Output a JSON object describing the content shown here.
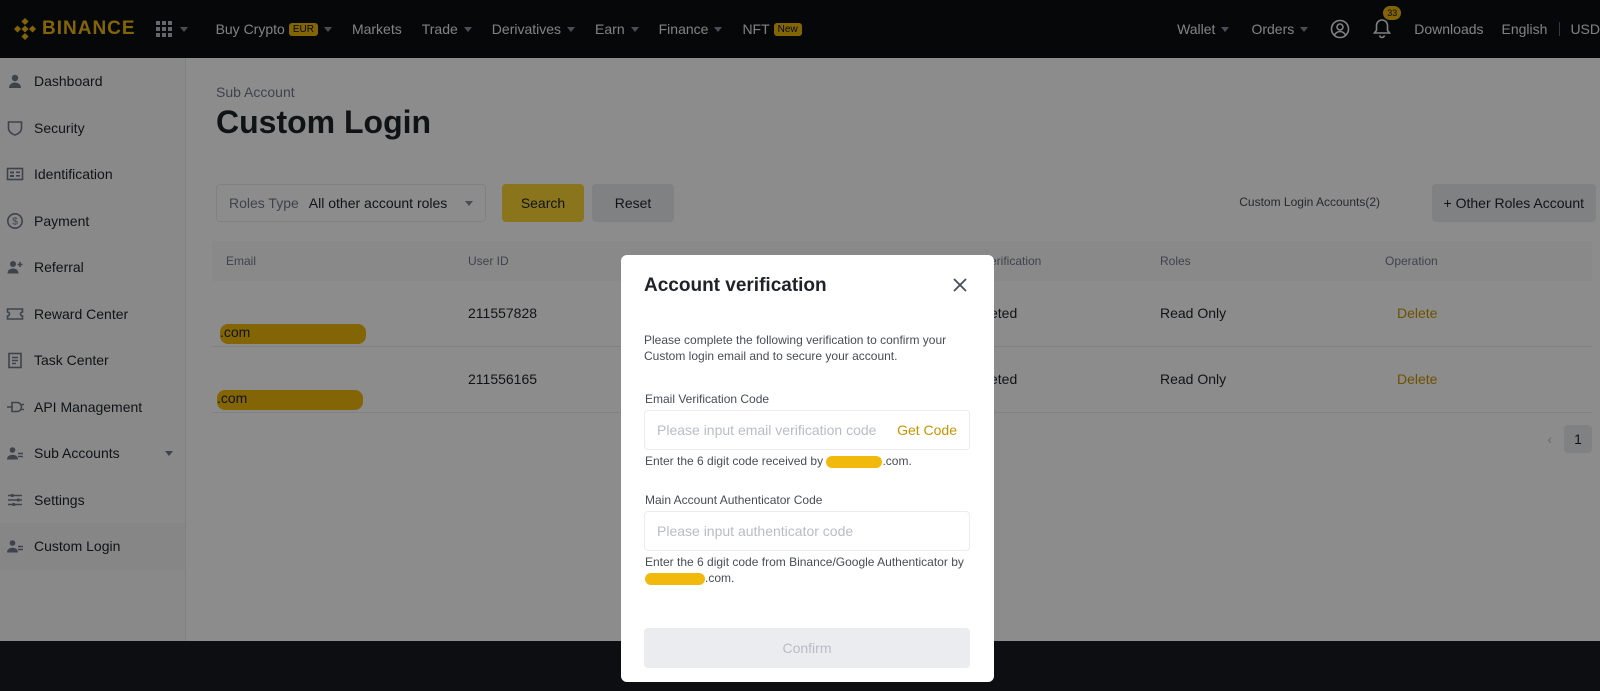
{
  "topbar": {
    "logo": "BINANCE",
    "nav": [
      {
        "label": "Buy Crypto",
        "badge": "EUR"
      },
      {
        "label": "Markets"
      },
      {
        "label": "Trade"
      },
      {
        "label": "Derivatives"
      },
      {
        "label": "Earn"
      },
      {
        "label": "Finance"
      },
      {
        "label": "NFT",
        "badge": "New"
      }
    ],
    "right": {
      "wallet": "Wallet",
      "orders": "Orders",
      "notification_count": "33",
      "downloads": "Downloads",
      "language": "English",
      "currency": "USD"
    }
  },
  "sidebar": {
    "items": [
      {
        "label": "Dashboard",
        "icon": "user-icon"
      },
      {
        "label": "Security",
        "icon": "shield-icon"
      },
      {
        "label": "Identification",
        "icon": "id-card-icon"
      },
      {
        "label": "Payment",
        "icon": "dollar-icon"
      },
      {
        "label": "Referral",
        "icon": "user-plus-icon"
      },
      {
        "label": "Reward Center",
        "icon": "ticket-icon"
      },
      {
        "label": "Task Center",
        "icon": "clipboard-icon"
      },
      {
        "label": "API Management",
        "icon": "plug-icon"
      },
      {
        "label": "Sub Accounts",
        "icon": "users-icon"
      },
      {
        "label": "Settings",
        "icon": "sliders-icon"
      },
      {
        "label": "Custom Login",
        "icon": "users-icon",
        "active": true
      }
    ]
  },
  "main": {
    "breadcrumb": "Sub Account",
    "title": "Custom Login",
    "filter": {
      "roles_type_label": "Roles Type",
      "roles_type_value": "All other account roles",
      "search": "Search",
      "reset": "Reset"
    },
    "custom_login_accounts": "Custom Login Accounts(2)",
    "other_roles_button": "+ Other Roles Account",
    "table": {
      "headers": [
        "Email",
        "User ID",
        "erification",
        "Roles",
        "Operation"
      ],
      "rows": [
        {
          "email_suffix": ".com",
          "user_id": "211557828",
          "status": "eted",
          "roles": "Read Only",
          "operation": "Delete"
        },
        {
          "email_suffix": ".com",
          "user_id": "211556165",
          "status": "eted",
          "roles": "Read Only",
          "operation": "Delete"
        }
      ]
    },
    "pagination": {
      "current": "1"
    }
  },
  "modal": {
    "title": "Account verification",
    "description": "Please complete the following verification to confirm your Custom login email and to secure your account.",
    "email_code": {
      "label": "Email Verification Code",
      "placeholder": "Please input email verification code",
      "get_code": "Get Code",
      "hint_prefix": "Enter the 6 digit code received by",
      "hint_suffix": ".com."
    },
    "auth_code": {
      "label": "Main Account Authenticator Code",
      "placeholder": "Please input authenticator code",
      "hint_prefix": "Enter the 6 digit code from Binance/Google Authenticator by",
      "hint_suffix": ".com."
    },
    "confirm": "Confirm"
  },
  "colors": {
    "brand": "#f0b90b",
    "button_yellow": "#fcd535",
    "link": "#c99400"
  }
}
